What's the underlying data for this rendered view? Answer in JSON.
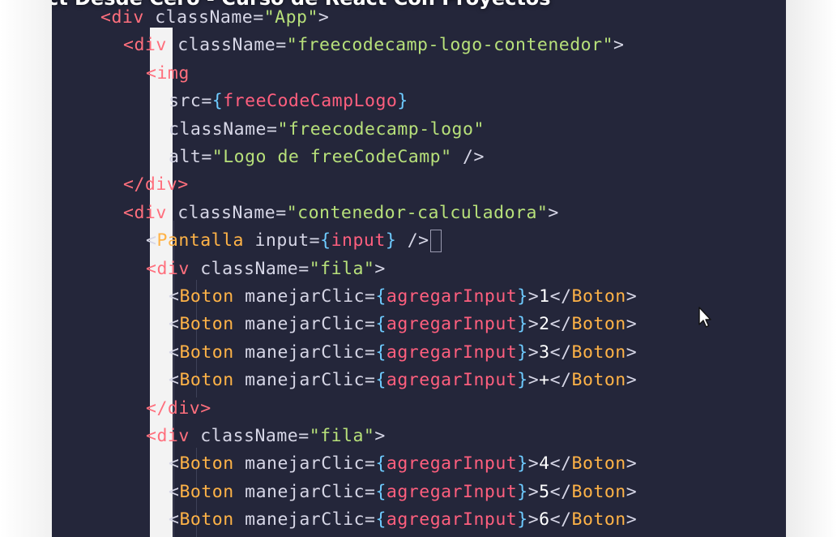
{
  "video": {
    "title_partial": "ct Desde Cero - Curso de React Con Proyectos"
  },
  "code_lines": [
    {
      "indent": 0,
      "tokens": [
        [
          "t",
          "<div "
        ],
        [
          "p",
          "className="
        ],
        [
          "s",
          "\"App\""
        ],
        [
          "p",
          ">"
        ]
      ]
    },
    {
      "indent": 1,
      "tokens": [
        [
          "t",
          "<div "
        ],
        [
          "p",
          "className="
        ],
        [
          "s",
          "\"freecodecamp-logo-contenedor\""
        ],
        [
          "p",
          ">"
        ]
      ]
    },
    {
      "indent": 2,
      "tokens": [
        [
          "t",
          "<img"
        ]
      ]
    },
    {
      "indent": 3,
      "tokens": [
        [
          "p",
          "src="
        ],
        [
          "b",
          "{"
        ],
        [
          "x",
          "freeCodeCampLogo"
        ],
        [
          "b",
          "}"
        ]
      ]
    },
    {
      "indent": 3,
      "tokens": [
        [
          "p",
          "className="
        ],
        [
          "s",
          "\"freecodecamp-logo\""
        ]
      ]
    },
    {
      "indent": 3,
      "tokens": [
        [
          "p",
          "alt="
        ],
        [
          "s",
          "\"Logo de freeCodeCamp\""
        ],
        [
          "p",
          " />"
        ]
      ]
    },
    {
      "indent": 1,
      "tokens": [
        [
          "t",
          "</div>"
        ]
      ]
    },
    {
      "indent": 1,
      "tokens": [
        [
          "t",
          "<div "
        ],
        [
          "p",
          "className="
        ],
        [
          "s",
          "\"contenedor-calculadora\""
        ],
        [
          "p",
          ">"
        ]
      ]
    },
    {
      "indent": 2,
      "tokens": [
        [
          "p",
          "<"
        ],
        [
          "c",
          "Pantalla "
        ],
        [
          "p",
          "input="
        ],
        [
          "b",
          "{"
        ],
        [
          "x",
          "input"
        ],
        [
          "b",
          "}"
        ],
        [
          "p",
          " /"
        ],
        [
          "p",
          ">"
        ]
      ],
      "cursor": true
    },
    {
      "indent": 2,
      "tokens": [
        [
          "t",
          "<div "
        ],
        [
          "p",
          "className="
        ],
        [
          "s",
          "\"fila\""
        ],
        [
          "p",
          ">"
        ]
      ]
    },
    {
      "indent": 3,
      "tokens": [
        [
          "p",
          "<"
        ],
        [
          "c",
          "Boton "
        ],
        [
          "p",
          "manejarClic="
        ],
        [
          "b",
          "{"
        ],
        [
          "x",
          "agregarInput"
        ],
        [
          "b",
          "}"
        ],
        [
          "p",
          ">"
        ],
        [
          "w",
          "1"
        ],
        [
          "p",
          "</"
        ],
        [
          "c",
          "Boton"
        ],
        [
          "p",
          ">"
        ]
      ]
    },
    {
      "indent": 3,
      "tokens": [
        [
          "p",
          "<"
        ],
        [
          "c",
          "Boton "
        ],
        [
          "p",
          "manejarClic="
        ],
        [
          "b",
          "{"
        ],
        [
          "x",
          "agregarInput"
        ],
        [
          "b",
          "}"
        ],
        [
          "p",
          ">"
        ],
        [
          "w",
          "2"
        ],
        [
          "p",
          "</"
        ],
        [
          "c",
          "Boton"
        ],
        [
          "p",
          ">"
        ]
      ]
    },
    {
      "indent": 3,
      "tokens": [
        [
          "p",
          "<"
        ],
        [
          "c",
          "Boton "
        ],
        [
          "p",
          "manejarClic="
        ],
        [
          "b",
          "{"
        ],
        [
          "x",
          "agregarInput"
        ],
        [
          "b",
          "}"
        ],
        [
          "p",
          ">"
        ],
        [
          "w",
          "3"
        ],
        [
          "p",
          "</"
        ],
        [
          "c",
          "Boton"
        ],
        [
          "p",
          ">"
        ]
      ]
    },
    {
      "indent": 3,
      "tokens": [
        [
          "p",
          "<"
        ],
        [
          "c",
          "Boton "
        ],
        [
          "p",
          "manejarClic="
        ],
        [
          "b",
          "{"
        ],
        [
          "x",
          "agregarInput"
        ],
        [
          "b",
          "}"
        ],
        [
          "p",
          ">"
        ],
        [
          "w",
          "+"
        ],
        [
          "p",
          "</"
        ],
        [
          "c",
          "Boton"
        ],
        [
          "p",
          ">"
        ]
      ]
    },
    {
      "indent": 2,
      "tokens": [
        [
          "t",
          "</div>"
        ]
      ]
    },
    {
      "indent": 2,
      "tokens": [
        [
          "t",
          "<div "
        ],
        [
          "p",
          "className="
        ],
        [
          "s",
          "\"fila\""
        ],
        [
          "p",
          ">"
        ]
      ]
    },
    {
      "indent": 3,
      "tokens": [
        [
          "p",
          "<"
        ],
        [
          "c",
          "Boton "
        ],
        [
          "p",
          "manejarClic="
        ],
        [
          "b",
          "{"
        ],
        [
          "x",
          "agregarInput"
        ],
        [
          "b",
          "}"
        ],
        [
          "p",
          ">"
        ],
        [
          "w",
          "4"
        ],
        [
          "p",
          "</"
        ],
        [
          "c",
          "Boton"
        ],
        [
          "p",
          ">"
        ]
      ]
    },
    {
      "indent": 3,
      "tokens": [
        [
          "p",
          "<"
        ],
        [
          "c",
          "Boton "
        ],
        [
          "p",
          "manejarClic="
        ],
        [
          "b",
          "{"
        ],
        [
          "x",
          "agregarInput"
        ],
        [
          "b",
          "}"
        ],
        [
          "p",
          ">"
        ],
        [
          "w",
          "5"
        ],
        [
          "p",
          "</"
        ],
        [
          "c",
          "Boton"
        ],
        [
          "p",
          ">"
        ]
      ]
    },
    {
      "indent": 3,
      "tokens": [
        [
          "p",
          "<"
        ],
        [
          "c",
          "Boton "
        ],
        [
          "p",
          "manejarClic="
        ],
        [
          "b",
          "{"
        ],
        [
          "x",
          "agregarInput"
        ],
        [
          "b",
          "}"
        ],
        [
          "p",
          ">"
        ],
        [
          "w",
          "6"
        ],
        [
          "p",
          "</"
        ],
        [
          "c",
          "Boton"
        ],
        [
          "p",
          ">"
        ]
      ]
    }
  ],
  "colors": {
    "editor_bg": "#24263a",
    "tag": "#ff6f7d",
    "component": "#ffb347",
    "string": "#b7e07a",
    "brace": "#6ecbff",
    "expression": "#ff5f7e"
  },
  "icons": {
    "mouse": "mouse-pointer-icon"
  }
}
